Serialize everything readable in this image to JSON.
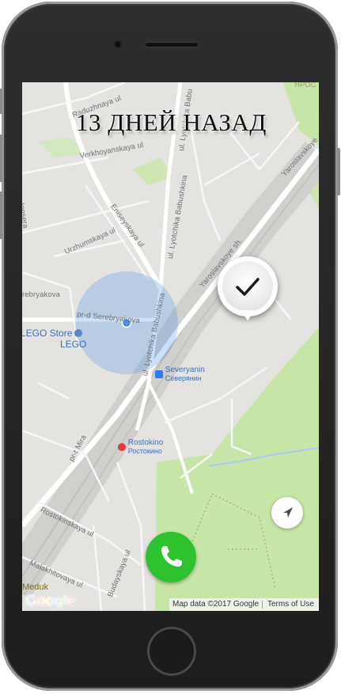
{
  "overlay": {
    "days_ago": "13 ДНЕЙ НАЗАД"
  },
  "map": {
    "streets": [
      {
        "name": "Raduzhnaya ul"
      },
      {
        "name": "Verkhoyanskaya ul"
      },
      {
        "name": "Eniseyskaya ul"
      },
      {
        "name": "ul. Lyotchika Babushkina"
      },
      {
        "name": "ul. Lyotchika Babushkina"
      },
      {
        "name": "Urzhumskaya ul"
      },
      {
        "name": "pr-d Serebryakova"
      },
      {
        "name": "Yaroslavskoye sh."
      },
      {
        "name": "Yaroslavskoye"
      },
      {
        "name": "pr-t Mira"
      },
      {
        "name": "Rostokinskaya ul"
      },
      {
        "name": "Malakhitovaya ul"
      },
      {
        "name": "Budayskaya ul"
      },
      {
        "name": "ul. Lyotchika Babu"
      },
      {
        "name": "rebryakova"
      },
      {
        "name": "lensera"
      },
      {
        "name": "ЯРОС"
      }
    ],
    "pois": {
      "lego_store": "LEGO Store",
      "lego": "LEGO",
      "station1_en": "Severyanin",
      "station1_ru": "Северянин",
      "station2_en": "Rostokino",
      "station2_ru": "Ростокино",
      "partial": "Meduk"
    },
    "brand": "Google",
    "attribution": "Map data ©2017 Google",
    "terms": "Terms of Use"
  },
  "buttons": {
    "checkin_icon": "checkmark-icon",
    "location_icon": "navigation-arrow-icon",
    "call_icon": "phone-icon"
  },
  "colors": {
    "call_green": "#2ec32e",
    "park_green": "#c8e5a8",
    "location_blue": "#4a8ee8"
  }
}
